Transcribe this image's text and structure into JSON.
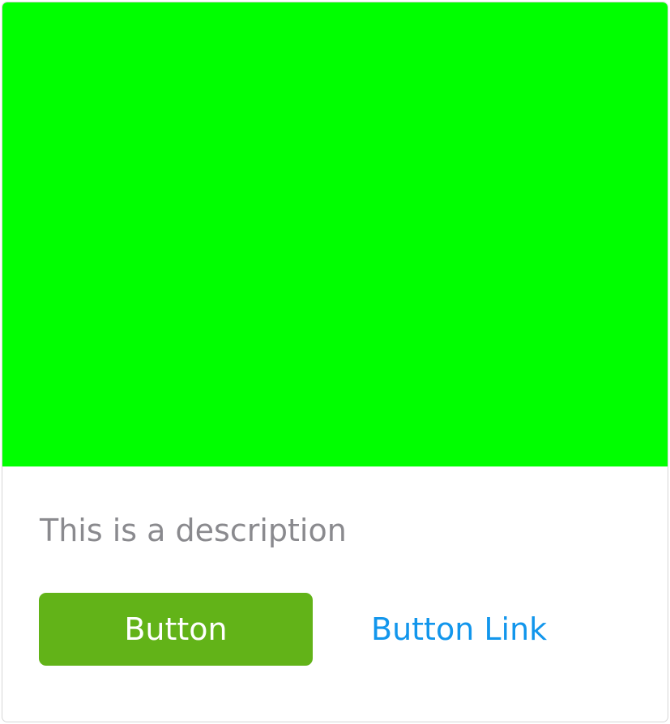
{
  "card": {
    "media_color": "#00ff00",
    "description": "This is a description",
    "primary_button_label": "Button",
    "link_button_label": "Button Link"
  },
  "colors": {
    "primary_button_bg": "#62b318",
    "link_text": "#1296ec",
    "description_text": "#8a8a8e",
    "card_border": "#d6d6d6"
  }
}
